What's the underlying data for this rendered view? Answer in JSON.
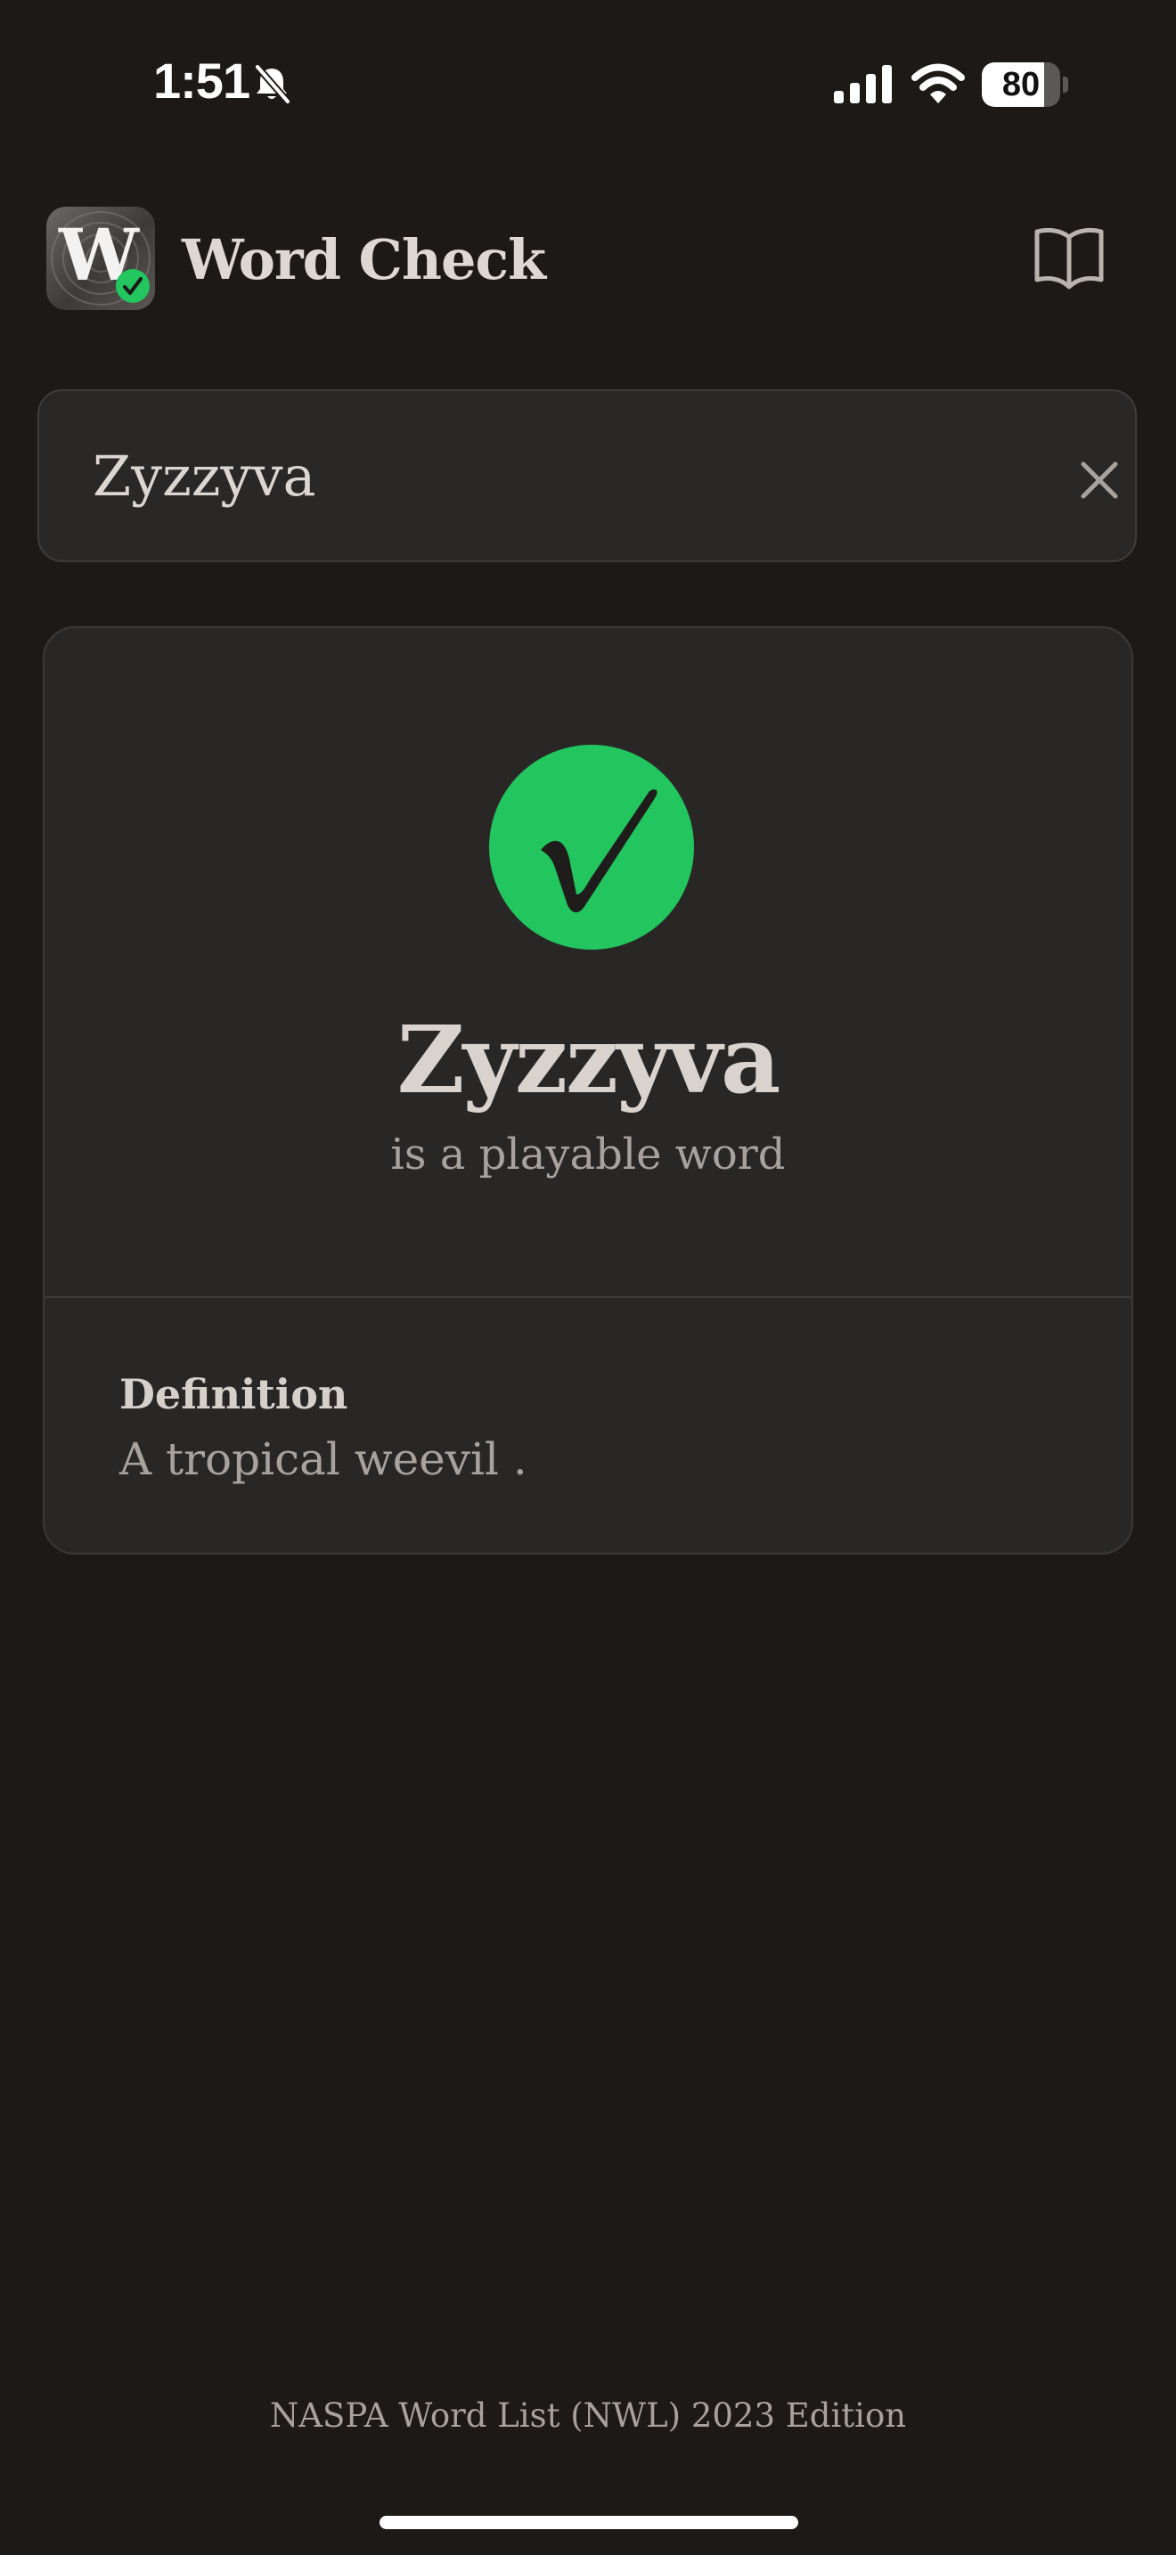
{
  "status_bar": {
    "time": "1:51",
    "battery": "80",
    "battery_level": 0.8,
    "icons": [
      "bell-slash-icon",
      "cellular-signal-icon",
      "wifi-icon",
      "battery-icon"
    ]
  },
  "header": {
    "logo_letter": "W",
    "title": "Word Check",
    "book_icon": "open-book-icon"
  },
  "search": {
    "value": "Zyzzyva",
    "clear_icon": "close-icon"
  },
  "result": {
    "status": "valid",
    "status_icon": "check-circle-icon",
    "word": "Zyzzyva",
    "caption": "is a playable word",
    "definition_label": "Definition",
    "definition_text": "A tropical weevil ."
  },
  "footer": {
    "note": "NASPA Word List (NWL) 2023 Edition"
  },
  "colors": {
    "background": "#1c1917",
    "card": "#292726",
    "accent_green": "#22c55e",
    "text_primary": "#d9d2cd",
    "text_secondary": "#a8a29e"
  }
}
